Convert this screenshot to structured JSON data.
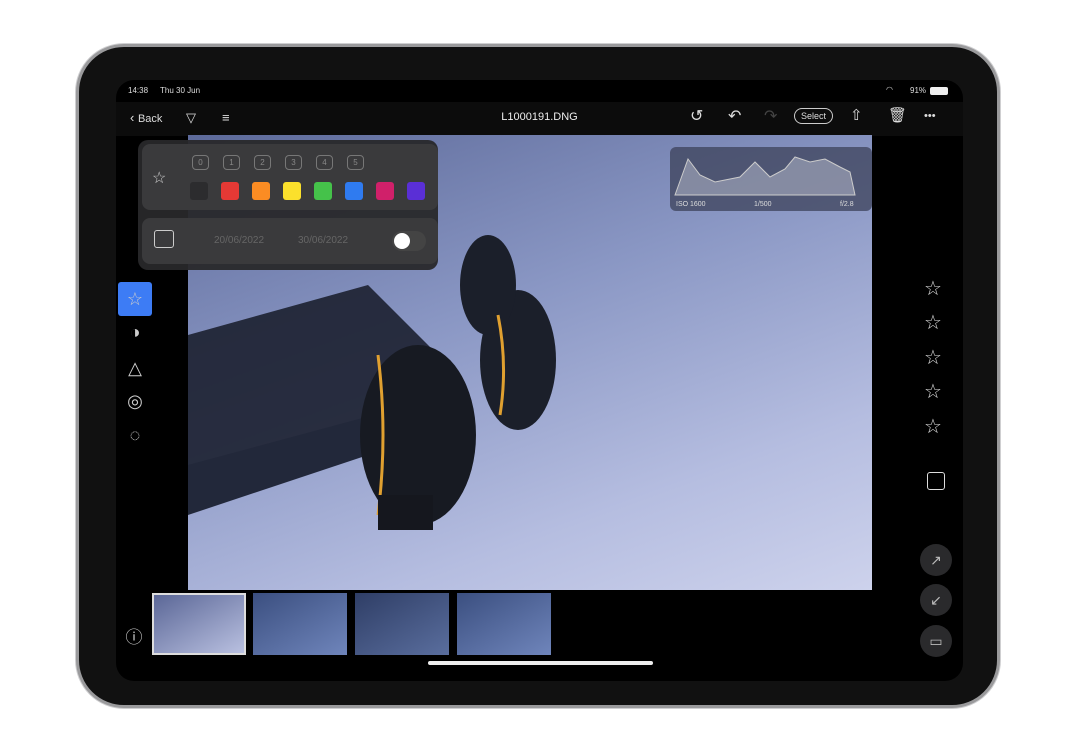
{
  "status": {
    "time": "14:38",
    "date": "Thu 30 Jun",
    "battery": "91%"
  },
  "toolbar": {
    "back_label": "Back",
    "file_name": "L1000191.DNG",
    "select_label": "Select",
    "more": "•••"
  },
  "filter_panel": {
    "rating_numbers": [
      "0",
      "1",
      "2",
      "3",
      "4",
      "5"
    ],
    "colors": [
      "#2c2c2e",
      "#e53935",
      "#fb8c23",
      "#fbe02c",
      "#45c24a",
      "#2f7bf0",
      "#d0206a",
      "#5a2fd6"
    ],
    "date_from": "20/06/2022",
    "date_to": "30/06/2022",
    "date_toggle_on": true
  },
  "histogram": {
    "iso": "ISO 1600",
    "shutter": "1/500",
    "aperture": "f/2.8"
  },
  "rating": {
    "stars": 0,
    "max": 5
  },
  "filmstrip": {
    "count": 4,
    "selected": 0
  },
  "accent": "#3d7cf5"
}
